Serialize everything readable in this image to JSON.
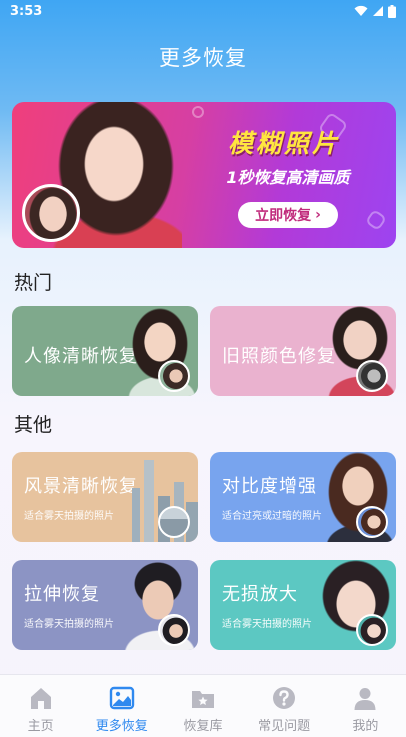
{
  "status_bar": {
    "time": "3:53"
  },
  "header": {
    "title": "更多恢复"
  },
  "banner": {
    "title": "模糊照片",
    "subtitle": "1秒恢复高清画质",
    "button_label": "立即恢复",
    "button_chevron": "›"
  },
  "sections": {
    "hot": "热门",
    "other": "其他"
  },
  "cards": {
    "portrait": {
      "title": "人像清晰恢复"
    },
    "old_photo": {
      "title": "旧照颜色修复"
    },
    "landscape": {
      "title": "风景清晰恢复",
      "desc": "适合雾天拍摄的照片"
    },
    "contrast": {
      "title": "对比度增强",
      "desc": "适合过亮或过暗的照片"
    },
    "stretch": {
      "title": "拉伸恢复",
      "desc": "适合雾天拍摄的照片"
    },
    "upscale": {
      "title": "无损放大",
      "desc": "适合雾天拍摄的照片"
    }
  },
  "tabbar": {
    "items": [
      {
        "label": "主页",
        "icon": "home-icon"
      },
      {
        "label": "更多恢复",
        "icon": "image-icon",
        "active": true
      },
      {
        "label": "恢复库",
        "icon": "folder-star-icon"
      },
      {
        "label": "常见问题",
        "icon": "question-icon"
      },
      {
        "label": "我的",
        "icon": "user-icon"
      }
    ]
  },
  "colors": {
    "accent": "#2f89ef",
    "card_portrait": "#7fa98c",
    "card_old_photo": "#eab2cf",
    "card_landscape": "#e7c39e",
    "card_contrast": "#78a4ee",
    "card_stretch": "#8c94c4",
    "card_upscale": "#5cc8c2"
  }
}
